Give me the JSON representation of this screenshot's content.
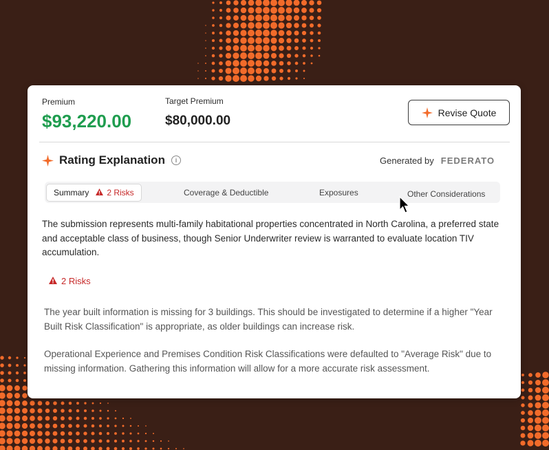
{
  "colors": {
    "accent": "#f26b2a",
    "premium_green": "#1f9d4f",
    "risk_red": "#c62828",
    "background": "#3a1f16"
  },
  "header": {
    "premium_label": "Premium",
    "premium_value": "$93,220.00",
    "target_label": "Target Premium",
    "target_value": "$80,000.00",
    "revise_button": {
      "label": "Revise Quote",
      "icon": "sparkle-icon"
    }
  },
  "rating": {
    "title": "Rating Explanation",
    "info_icon": "info-icon",
    "generated_by": "Generated by",
    "brand": "FEDERATO"
  },
  "tabs": [
    {
      "label": "Summary",
      "badge": "2 Risks",
      "active": true
    },
    {
      "label": "Coverage & Deductible"
    },
    {
      "label": "Exposures"
    },
    {
      "label": "Other Considerations"
    }
  ],
  "summary": {
    "text": "The submission represents multi-family habitational properties concentrated in North Carolina, a preferred state and acceptable class of business, though Senior Underwriter review is warranted to evaluate location TIV accumulation.",
    "risks_label": "2 Risks",
    "risks": [
      "The year built information is missing for 3 buildings. This should be investigated to determine if a higher \"Year Built Risk Classification\" is appropriate, as older buildings can increase risk.",
      "Operational Experience and Premises Condition Risk Classifications were defaulted to \"Average Risk\" due to missing information. Gathering this information will allow for a more accurate risk assessment."
    ]
  }
}
